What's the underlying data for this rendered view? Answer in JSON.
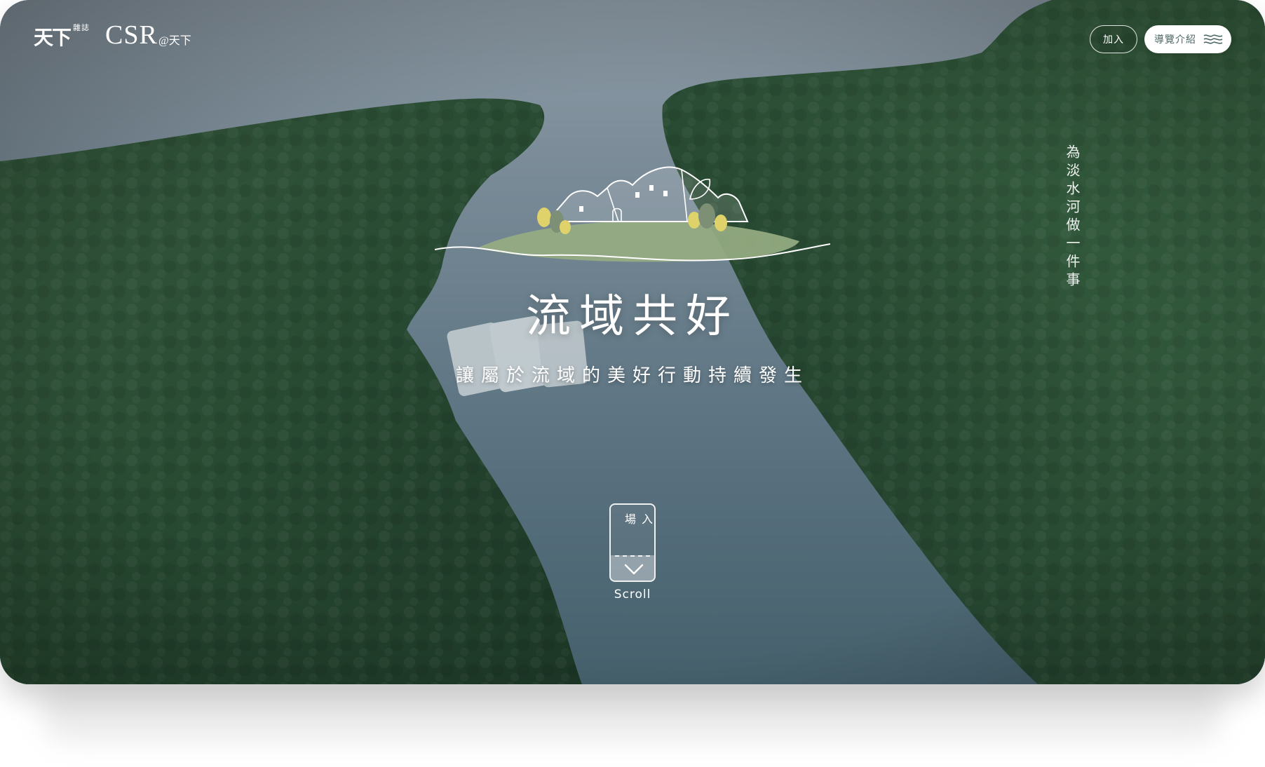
{
  "brand": {
    "magazine_logo": "天下",
    "magazine_sub": "雜誌",
    "csr_logo": "CSR",
    "csr_suffix": "@天下"
  },
  "header": {
    "join_label": "加入",
    "guide_label": "導覽介紹",
    "guide_icon": "waves-icon"
  },
  "hero": {
    "vertical_tagline": "為淡水河做一件事",
    "title": "流域共好",
    "subtitle": "讓屬於流域的美好行動持續發生",
    "enter_chars": [
      "入",
      "場"
    ],
    "scroll_label": "Scroll"
  },
  "colors": {
    "river": "#5e7583",
    "forest_dark": "#1f3a2b",
    "forest_mid": "#3f6b4a",
    "emblem_green": "#96ad82",
    "emblem_yellow": "#e0d26b",
    "button_text": "#4f6666"
  }
}
